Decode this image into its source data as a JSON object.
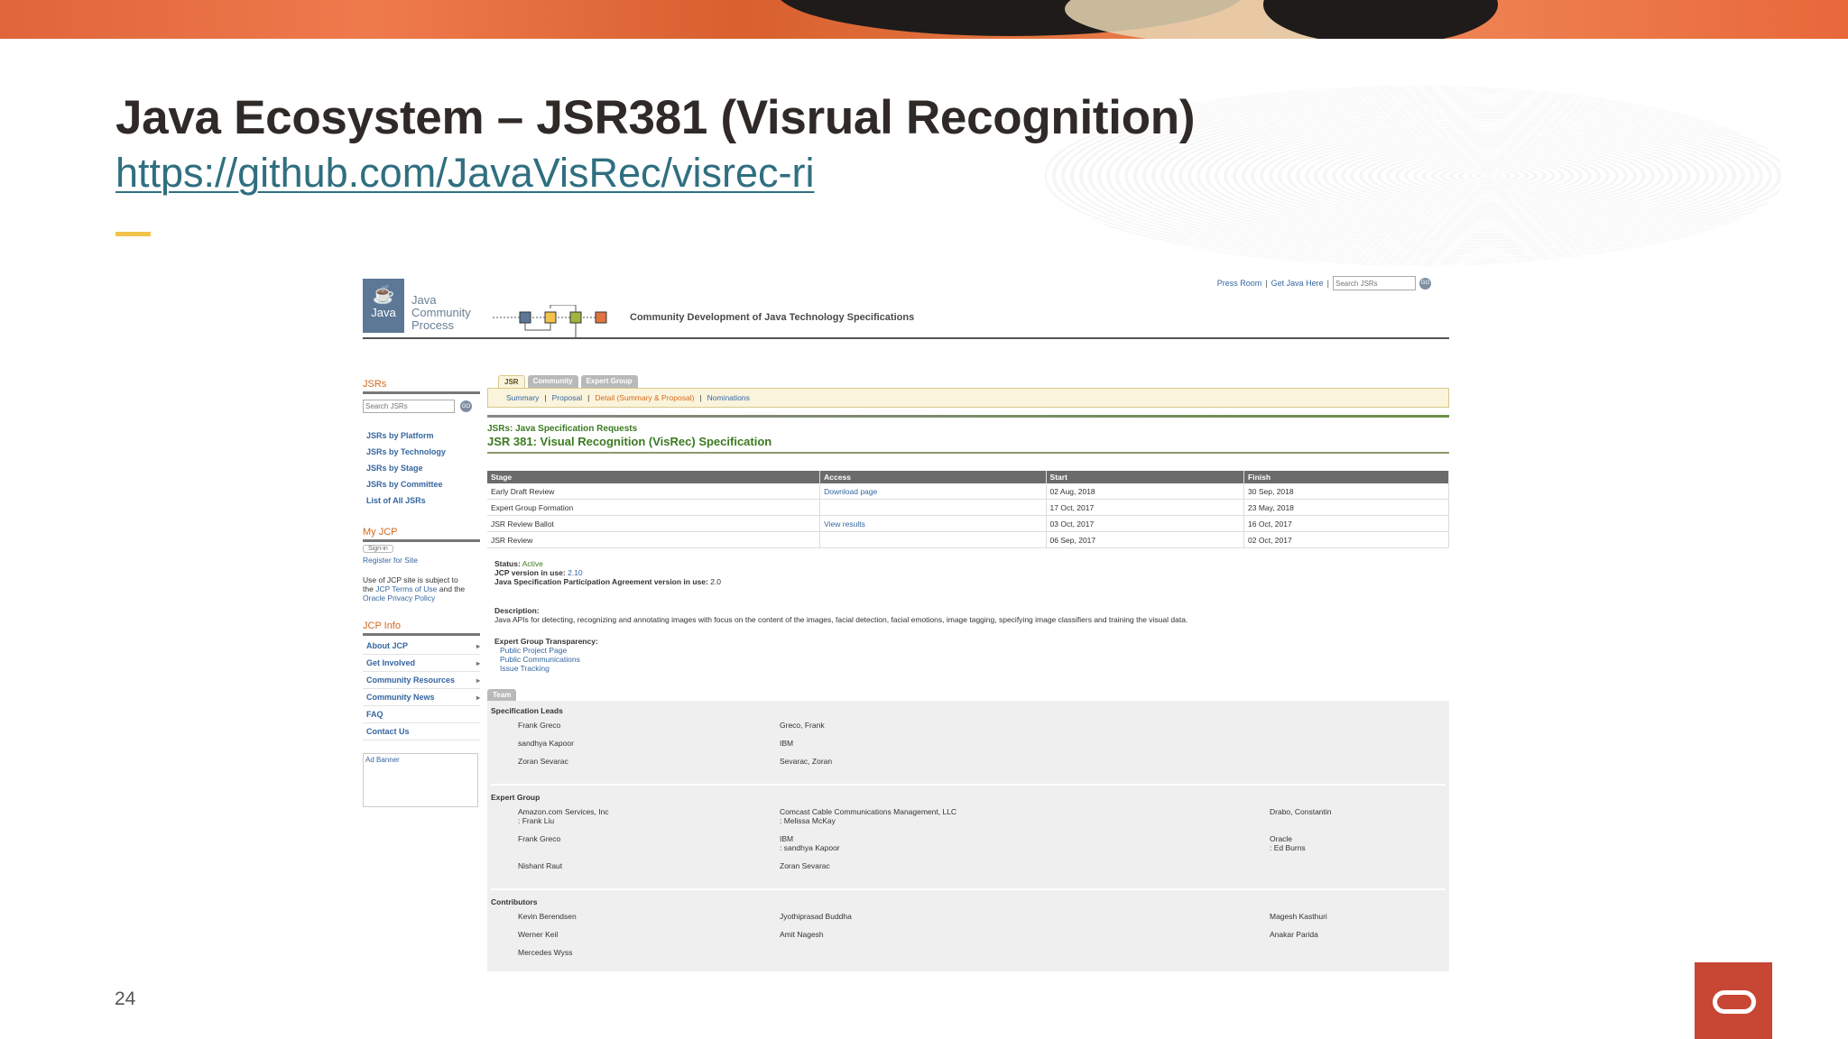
{
  "slide": {
    "title": "Java Ecosystem – JSR381 (Visrual Recognition)",
    "link": "https://github.com/JavaVisRec/visrec-ri",
    "page_number": "24"
  },
  "screenshot": {
    "top_nav": {
      "press_room": "Press Room",
      "get_java": "Get Java Here",
      "search_placeholder": "Search JSRs",
      "go": "GO"
    },
    "logo": {
      "java": "Java",
      "line1": "Java",
      "line2": "Community",
      "line3": "Process"
    },
    "tagline": "Community Development of Java Technology Specifications",
    "left": {
      "jsrs_heading": "JSRs",
      "search_placeholder": "Search JSRs",
      "go": "GO",
      "jsr_links": [
        "JSRs by Platform",
        "JSRs by Technology",
        "JSRs by Stage",
        "JSRs by Committee",
        "List of All JSRs"
      ],
      "myjcp_heading": "My JCP",
      "sign_in": "Sign-in",
      "register": "Register for Site",
      "terms_1": "Use of JCP site is subject to",
      "terms_2": "the ",
      "terms_link": "JCP Terms of Use",
      "terms_3": " and the",
      "privacy_link": "Oracle Privacy Policy",
      "jcpinfo_heading": "JCP Info",
      "info_links": [
        "About JCP",
        "Get Involved",
        "Community Resources",
        "Community News",
        "FAQ",
        "Contact Us"
      ],
      "ad_banner": "Ad Banner"
    },
    "tabs": [
      "JSR",
      "Community",
      "Expert Group"
    ],
    "subnav": {
      "summary": "Summary",
      "proposal": "Proposal",
      "detail": "Detail (Summary & Proposal)",
      "nominations": "Nominations",
      "sep": "|"
    },
    "crumb": "JSRs: Java Specification Requests",
    "jsr_title": "JSR 381: Visual Recognition (VisRec) Specification",
    "stage_table": {
      "headers": [
        "Stage",
        "Access",
        "Start",
        "Finish"
      ],
      "rows": [
        [
          "Early Draft Review",
          "Download page",
          "02 Aug, 2018",
          "30 Sep, 2018"
        ],
        [
          "Expert Group Formation",
          "",
          "17 Oct, 2017",
          "23 May, 2018"
        ],
        [
          "JSR Review Ballot",
          "View results",
          "03 Oct, 2017",
          "16 Oct, 2017"
        ],
        [
          "JSR Review",
          "",
          "06 Sep, 2017",
          "02 Oct, 2017"
        ]
      ]
    },
    "status": {
      "status_label": "Status:",
      "status_value": "Active",
      "jcp_label": "JCP version in use:",
      "jcp_value": "2.10",
      "jspa_label": "Java Specification Participation Agreement version in use:",
      "jspa_value": "2.0"
    },
    "description": {
      "label": "Description:",
      "text": "Java APIs for detecting, recognizing and annotating images with focus on the content of the images, facial detection, facial emotions, image tagging, specifying image classifiers and training the visual data."
    },
    "transparency": {
      "label": "Expert Group Transparency:",
      "links": [
        "Public Project Page",
        "Public Communications",
        "Issue Tracking"
      ]
    },
    "team_tab": "Team",
    "spec_leads": {
      "heading": "Specification Leads",
      "rows": [
        [
          "Frank Greco",
          "Greco, Frank",
          ""
        ],
        [
          "sandhya Kapoor",
          "IBM",
          ""
        ],
        [
          "Zoran Sevarac",
          "Sevarac, Zoran",
          ""
        ]
      ]
    },
    "expert_group": {
      "heading": "Expert Group",
      "rows": [
        [
          "Amazon.com Services, Inc\n: Frank Liu",
          "Comcast Cable Communications Management, LLC\n: Melissa McKay",
          "Drabo, Constantin"
        ],
        [
          "Frank Greco",
          "IBM\n: sandhya Kapoor",
          "Oracle\n: Ed Burns"
        ],
        [
          "Nishant Raut",
          "Zoran Sevarac",
          ""
        ]
      ]
    },
    "contributors": {
      "heading": "Contributors",
      "rows": [
        [
          "Kevin Berendsen",
          "Jyothiprasad Buddha",
          "Magesh Kasthuri"
        ],
        [
          "Werner Keil",
          "Amit Nagesh",
          "Anakar Parida"
        ],
        [
          "Mercedes Wyss",
          "",
          ""
        ]
      ]
    }
  }
}
